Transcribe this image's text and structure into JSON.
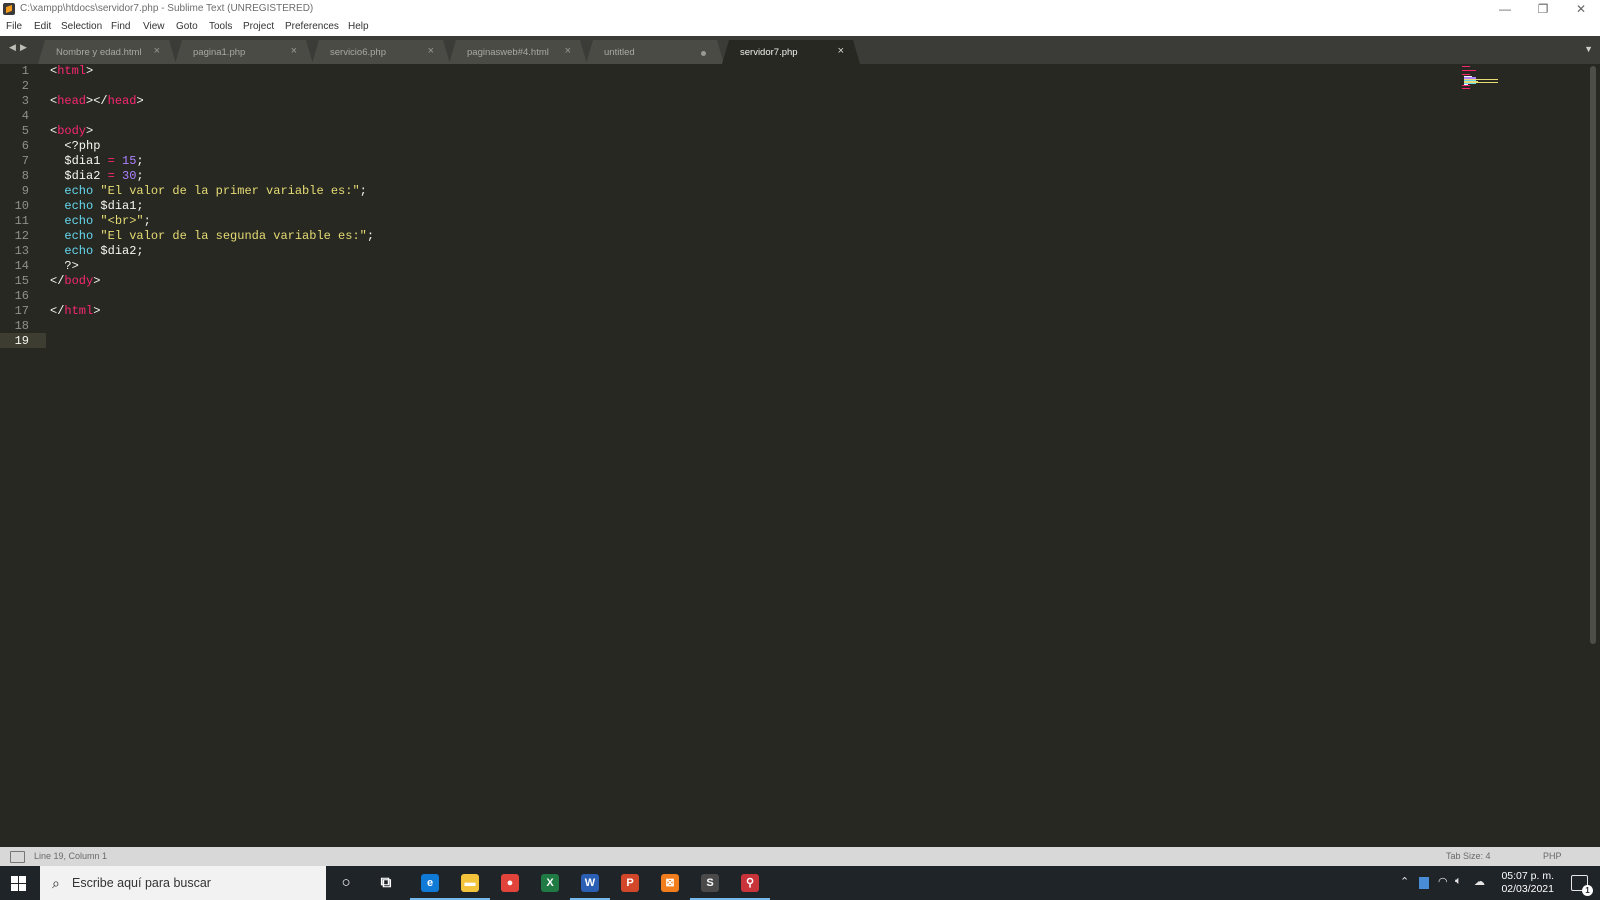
{
  "window": {
    "title": "C:\\xampp\\htdocs\\servidor7.php - Sublime Text (UNREGISTERED)",
    "controls": {
      "minimize": "—",
      "restore": "❐",
      "close": "✕"
    }
  },
  "menu": [
    "File",
    "Edit",
    "Selection",
    "Find",
    "View",
    "Goto",
    "Tools",
    "Project",
    "Preferences",
    "Help"
  ],
  "tabs": [
    {
      "label": "Nombre y edad.html",
      "state": "close"
    },
    {
      "label": "pagina1.php",
      "state": "close"
    },
    {
      "label": "servicio6.php",
      "state": "close"
    },
    {
      "label": "paginasweb#4.html",
      "state": "close"
    },
    {
      "label": "untitled",
      "state": "modified"
    },
    {
      "label": "servidor7.php",
      "state": "close",
      "active": true
    }
  ],
  "tab_nav": {
    "back": "◀",
    "forward": "▶",
    "menu": "▼"
  },
  "editor": {
    "line_numbers": [
      "1",
      "2",
      "3",
      "4",
      "5",
      "6",
      "7",
      "8",
      "9",
      "10",
      "11",
      "12",
      "13",
      "14",
      "15",
      "16",
      "17",
      "18",
      "19"
    ],
    "current_line": "19",
    "lines": [
      [
        {
          "t": "<",
          "c": "p"
        },
        {
          "t": "html",
          "c": "tag"
        },
        {
          "t": ">",
          "c": "p"
        }
      ],
      [],
      [
        {
          "t": "<",
          "c": "p"
        },
        {
          "t": "head",
          "c": "tag"
        },
        {
          "t": "></",
          "c": "p"
        },
        {
          "t": "head",
          "c": "tag"
        },
        {
          "t": ">",
          "c": "p"
        }
      ],
      [],
      [
        {
          "t": "<",
          "c": "p"
        },
        {
          "t": "body",
          "c": "tag"
        },
        {
          "t": ">",
          "c": "p"
        }
      ],
      [
        {
          "t": "  <?php",
          "c": "p"
        }
      ],
      [
        {
          "t": "  $dia1 ",
          "c": "p"
        },
        {
          "t": "=",
          "c": "op"
        },
        {
          "t": " ",
          "c": "p"
        },
        {
          "t": "15",
          "c": "num"
        },
        {
          "t": ";",
          "c": "p"
        }
      ],
      [
        {
          "t": "  $dia2 ",
          "c": "p"
        },
        {
          "t": "=",
          "c": "op"
        },
        {
          "t": " ",
          "c": "p"
        },
        {
          "t": "30",
          "c": "num"
        },
        {
          "t": ";",
          "c": "p"
        }
      ],
      [
        {
          "t": "  ",
          "c": "p"
        },
        {
          "t": "echo",
          "c": "kw"
        },
        {
          "t": " ",
          "c": "p"
        },
        {
          "t": "\"El valor de la primer variable es:\"",
          "c": "str"
        },
        {
          "t": ";",
          "c": "p"
        }
      ],
      [
        {
          "t": "  ",
          "c": "p"
        },
        {
          "t": "echo",
          "c": "kw"
        },
        {
          "t": " $dia1;",
          "c": "p"
        }
      ],
      [
        {
          "t": "  ",
          "c": "p"
        },
        {
          "t": "echo",
          "c": "kw"
        },
        {
          "t": " ",
          "c": "p"
        },
        {
          "t": "\"<br>\"",
          "c": "str"
        },
        {
          "t": ";",
          "c": "p"
        }
      ],
      [
        {
          "t": "  ",
          "c": "p"
        },
        {
          "t": "echo",
          "c": "kw"
        },
        {
          "t": " ",
          "c": "p"
        },
        {
          "t": "\"El valor de la segunda variable es:\"",
          "c": "str"
        },
        {
          "t": ";",
          "c": "p"
        }
      ],
      [
        {
          "t": "  ",
          "c": "p"
        },
        {
          "t": "echo",
          "c": "kw"
        },
        {
          "t": " $dia2;",
          "c": "p"
        }
      ],
      [
        {
          "t": "  ?>",
          "c": "p"
        }
      ],
      [
        {
          "t": "</",
          "c": "p"
        },
        {
          "t": "body",
          "c": "tag"
        },
        {
          "t": ">",
          "c": "p"
        }
      ],
      [],
      [
        {
          "t": "</",
          "c": "p"
        },
        {
          "t": "html",
          "c": "tag"
        },
        {
          "t": ">",
          "c": "p"
        }
      ],
      [],
      []
    ]
  },
  "status": {
    "position": "Line 19, Column 1",
    "tab_size": "Tab Size: 4",
    "syntax": "PHP"
  },
  "taskbar": {
    "search_placeholder": "Escribe aquí para buscar",
    "apps": [
      {
        "name": "cortana",
        "glyph": "○"
      },
      {
        "name": "task-view",
        "glyph": "⧉"
      },
      {
        "name": "edge",
        "glyph": "e",
        "color": "#0f7bd6"
      },
      {
        "name": "file-explorer",
        "glyph": "▬",
        "color": "#f3c33c"
      },
      {
        "name": "chrome",
        "glyph": "●",
        "color": "#e2433a"
      },
      {
        "name": "excel",
        "glyph": "X",
        "color": "#1f7a44"
      },
      {
        "name": "word",
        "glyph": "W",
        "color": "#2b5fb4"
      },
      {
        "name": "powerpoint",
        "glyph": "P",
        "color": "#d2472a"
      },
      {
        "name": "xampp",
        "glyph": "⊠",
        "color": "#f27d1d"
      },
      {
        "name": "sublime-text",
        "glyph": "S",
        "color": "#4a4a4a"
      },
      {
        "name": "git",
        "glyph": "⚲",
        "color": "#c8343a"
      }
    ],
    "clock_time": "05:07 p. m.",
    "clock_date": "02/03/2021",
    "notification_count": "1"
  },
  "colors": {
    "editor_bg": "#272822",
    "tag": "#f92672",
    "keyword": "#66d9ef",
    "string": "#e6db74",
    "number": "#ae81ff"
  }
}
